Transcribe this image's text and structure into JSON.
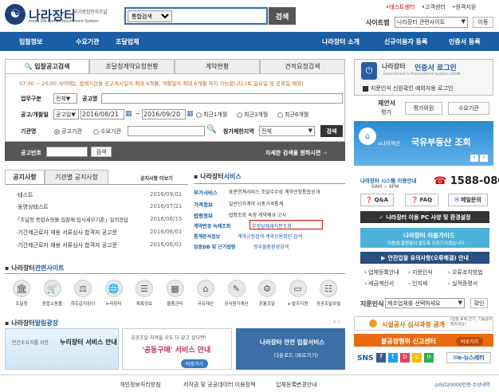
{
  "header": {
    "logo_mark": "☯",
    "logo_title": "나라장터",
    "logo_sub_kr": "국가종합전자조달",
    "logo_sub_en": "Korea ON-Line E-Procurement System",
    "search_scope": "통합검색",
    "search_button": "검색",
    "util_links": [
      "•테스트센터",
      "•고객센터",
      "•원격지원"
    ],
    "sitemap_label": "사이트맵",
    "related_select": "나라장터 관련사이트",
    "go_button": "이동"
  },
  "nav": {
    "left": [
      "입찰정보",
      "수요기관",
      "조달업체"
    ],
    "right": [
      "나라장터 소개",
      "신규이용자 등록",
      "인증서 등록"
    ]
  },
  "search": {
    "tabs": [
      "입찰공고검색",
      "조달청계약요청현황",
      "계약현황",
      "견적요청검색"
    ],
    "notice": "07:00 ~ 20:00 사이에는 검색기간을 공고게시일자 최대 6개월, 개찰일자 최대 6개월 까지 가능합니다.(토,일요일 및 공휴일 제외)",
    "type_label": "업무구분",
    "type_value": "전체",
    "name_label": "공고명",
    "period_label": "공고/개찰일",
    "period_value": "공고일",
    "date_from": "2016/08/21",
    "date_to": "2016/09/20",
    "tilde": "~",
    "ranges": [
      "최근1개월",
      "최근3개월",
      "최근6개월"
    ],
    "agency_label": "기관명",
    "agency_options": [
      "공고기관",
      "수요기관"
    ],
    "region_label": "참가제한지역",
    "region_value": "전체",
    "search_button": "검색",
    "no_label": "공고번호",
    "no_search_button": "검색",
    "detail_link": "자세한 검색을 원하시면"
  },
  "notices": {
    "tabs": [
      "공지사항",
      "기관별 공지사항"
    ],
    "more": "공지사항 더보기",
    "items": [
      {
        "title": "·테스트",
        "date": "2016/09/01"
      },
      {
        "title": "·동영상테스트",
        "date": "2016/07/21"
      },
      {
        "title": "·「조달청 종합쇼핑몰 입찰제 입사세부기준」일의응답",
        "date": "2016/06/15"
      },
      {
        "title": "·기간제근로자 채용 서류심사 합격자 공고문",
        "date": "2016/06/01"
      },
      {
        "title": "·기간제근로자 채용 서류심사 합격자 공고문",
        "date": "2016/06/01"
      }
    ]
  },
  "services": {
    "title_main": "나라장터",
    "title_rest": "서비스",
    "rows": [
      {
        "cat": "부가서비스",
        "text": "표준연계서비스  조달수수료  계약관정통합공개"
      },
      {
        "cat": "가격정보",
        "text": "일반단가계약  시중가격통계"
      },
      {
        "cat": "법령정보",
        "text": "법령조회  숙정  계약예규  고시"
      },
      {
        "cat": "계약변경 숙례조회",
        "text": "부정당제재처분조회"
      },
      {
        "cat": "통계분석정보",
        "text": "계약규정검색  계약신용확인 검색"
      },
      {
        "cat": "업종DB 및 근거법령",
        "text": "정부물품환경검색"
      }
    ]
  },
  "related": {
    "title_main": "나라장터",
    "title_rest": "관련사이트",
    "items": [
      {
        "icon": "building-icon",
        "label": "조달청"
      },
      {
        "icon": "mall-icon",
        "label": "종합쇼핑몰"
      },
      {
        "icon": "subcontract-icon",
        "label": "하도급지킴이"
      },
      {
        "icon": "nuri-icon",
        "label": "누리장터"
      },
      {
        "icon": "purchase-icon",
        "label": "목록정보"
      },
      {
        "icon": "catalog-icon",
        "label": "물품관리"
      },
      {
        "icon": "asset-icon",
        "label": "국유재산"
      },
      {
        "icon": "gongmae-icon",
        "label": "공사원가계산"
      },
      {
        "icon": "onbid-icon",
        "label": "온통조달"
      },
      {
        "icon": "epro-icon",
        "label": "e-발주지원"
      },
      {
        "icon": "public-icon",
        "label": "공공조달포털"
      }
    ]
  },
  "plaza": {
    "title_main": "나라장터",
    "title_rest": "알림광장",
    "banner1_small": "민간수요자를 위한",
    "banner1_big": "누리장터 서비스 안내",
    "banner2_top": "공공조달 자격을 모두 다 갖고 싶다면!",
    "banner2_mid": "'공동구매' 서비스 안내",
    "banner2_btn": "바로가기",
    "banner3_title": "나라장터 안전 입찰서비스",
    "banner3_sub": "다운로드 (바로가기)"
  },
  "right": {
    "login_brand": "나라장터",
    "login_title": "인증서 로그인",
    "login_sub": "Government e-Procurement System LOGIN",
    "checkbox_label": "지문인식 신원확인 예외자용 로그인",
    "proposal_label": "제안서",
    "proposal_sub": "평가",
    "btn_eval": "평가위원",
    "btn_agency": "수요기관",
    "asset_banner_small": "e나라재산",
    "asset_banner_big": "국유부동산 조회",
    "hours_label": "나라장터 시스템 이용안내",
    "hours": "9AM ~ 6PM",
    "phone": "1588-0800",
    "qa": "Q&A",
    "faq": "FAQ",
    "mail": "메일문의",
    "pc_support": "나라장터 이용 PC 사양 및 환경설정",
    "guide_title": "나라장터 이용가이드",
    "guide_sub": "이용에 불편함이 없도록 도와드리겠습니다.",
    "safety": "안전입찰 유의사항(오류해결) 안내",
    "links": [
      "업체등록안내",
      "지문인식",
      "오류조치방법",
      "세금계산서",
      "인지세",
      "실적증명서"
    ],
    "fingerprint_label": "지문인식",
    "fingerprint_select": "제조업체를 선택하세요",
    "confirm_button": "확인",
    "facility_banner": "시설공사 심사과정 공개",
    "facility_note": "(입찰,토목,전기, 기술용역 제외대상)",
    "fraud_banner": "불공정행위 신고센터",
    "fraud_btn": "바로가기",
    "sns": "SNS",
    "enews": "e-뉴스레터",
    "cert_mark": "ISO20000인증·수상내역"
  },
  "footer": {
    "links": [
      "개인정보처리방침",
      "저작권 및 공공데이터 이용정책",
      "입체등록변경안내"
    ]
  }
}
